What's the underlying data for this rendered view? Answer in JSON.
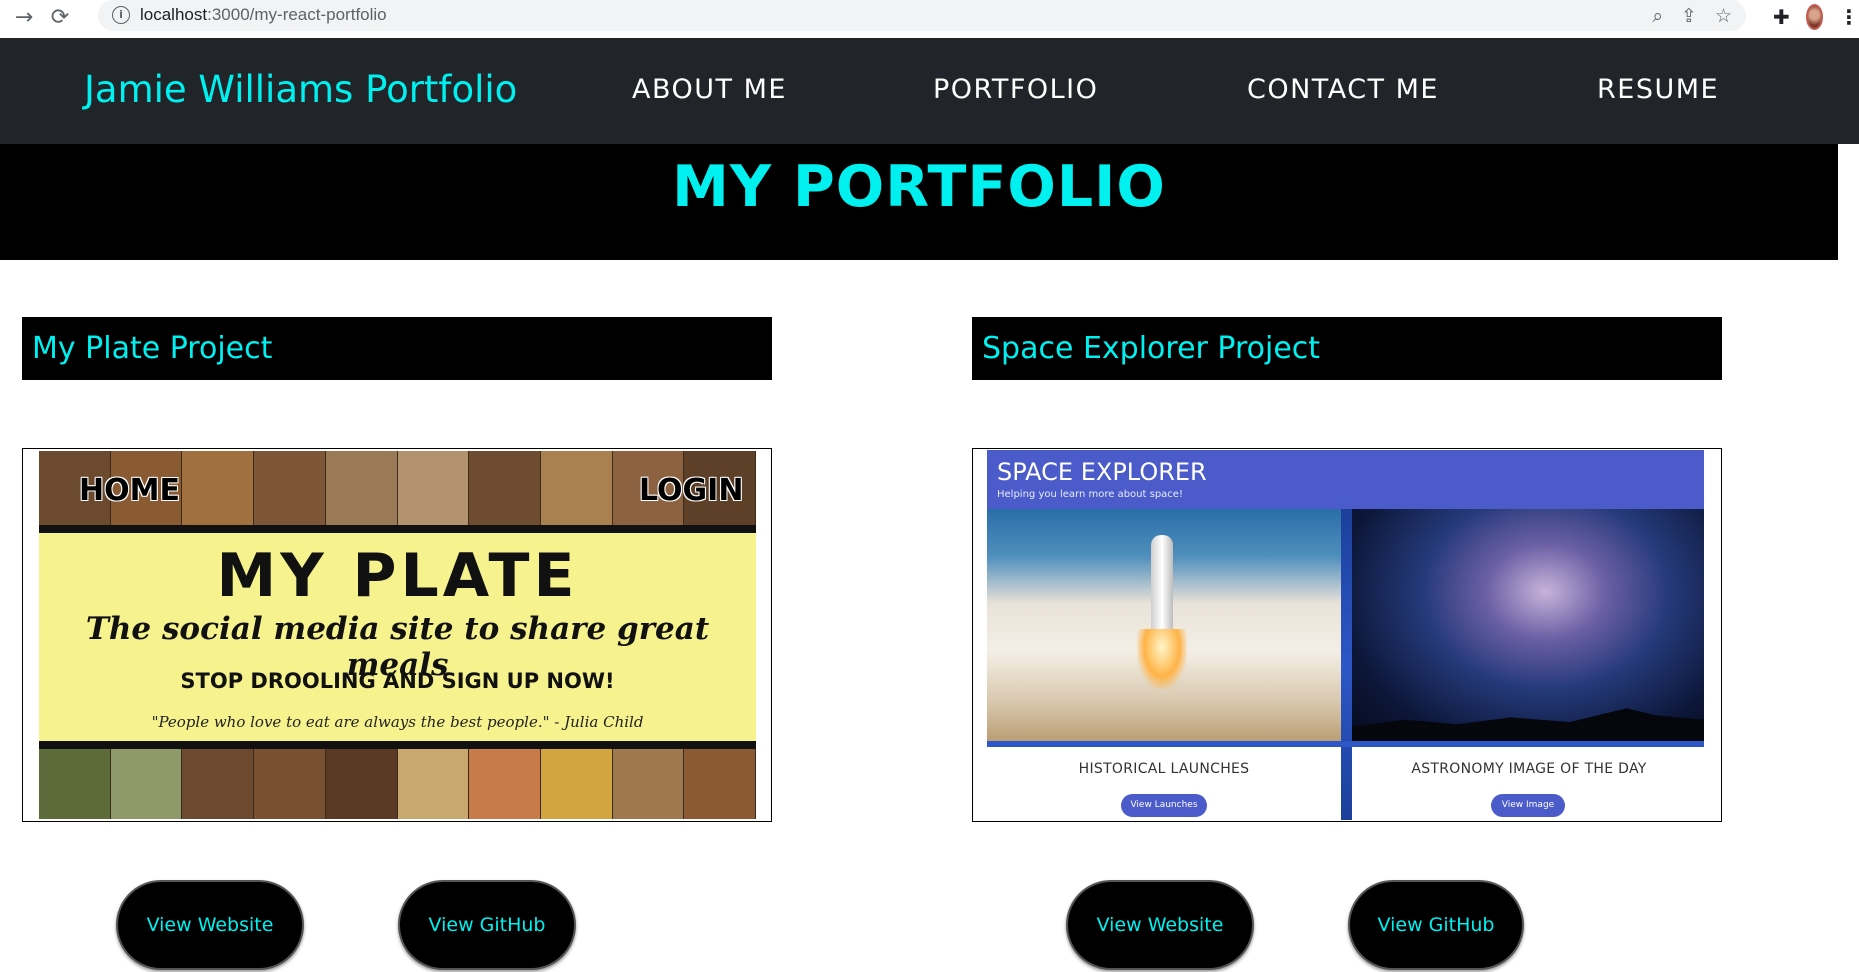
{
  "browser": {
    "back_icon": "arrow-right-icon",
    "reload_icon": "reload-icon",
    "url_host": "localhost",
    "url_path": ":3000/my-react-portfolio",
    "actions": [
      "zoom-icon",
      "share-icon",
      "star-icon"
    ],
    "extensions_icon": "puzzle-icon",
    "menu_icon": "kebab-icon"
  },
  "header": {
    "brand": "Jamie Williams Portfolio",
    "nav": [
      "ABOUT ME",
      "PORTFOLIO",
      "CONTACT ME",
      "RESUME"
    ]
  },
  "page": {
    "title": "MY PORTFOLIO"
  },
  "projects": [
    {
      "heading": "My Plate Project",
      "preview": {
        "nav_left": "HOME",
        "nav_right": "LOGIN",
        "title": "MY PLATE",
        "tagline": "The social media site to share great meals",
        "cta": "STOP DROOLING AND SIGN UP NOW!",
        "quote": "\"People who love to eat are always the best people.\" - Julia Child"
      },
      "buttons": [
        "View Website",
        "View GitHub"
      ]
    },
    {
      "heading": "Space Explorer Project",
      "preview": {
        "title": "SPACE EXPLORER",
        "subtitle": "Helping you learn more about space!",
        "card1_label": "HISTORICAL LAUNCHES",
        "card1_button": "View Launches",
        "card2_label": "ASTRONOMY IMAGE OF THE DAY",
        "card2_button": "View Image"
      },
      "buttons": [
        "View Website",
        "View GitHub"
      ]
    }
  ],
  "colors": {
    "accent": "#00f0f0",
    "header_bg": "#212529",
    "title_bg": "#000000",
    "space_brand": "#4b5bc9"
  }
}
